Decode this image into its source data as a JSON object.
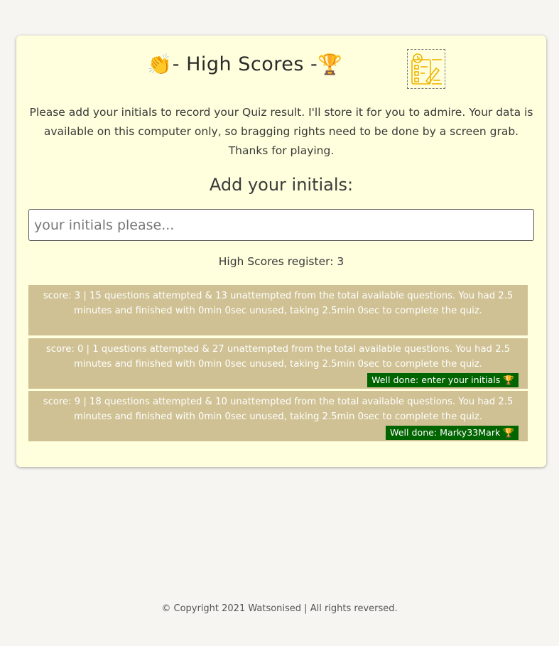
{
  "header": {
    "title_left_emoji": "👏",
    "title_text": "- High Scores -",
    "title_right_emoji": "🏆",
    "logo_icon": "quiz-clipboard-icon"
  },
  "intro": {
    "text": "Please add your initials to record your Quiz result. I'll store it for you to admire. Your data is available on this computer only, so bragging rights need to be done by a screen grab. Thanks for playing."
  },
  "form": {
    "heading": "Add your initials:",
    "placeholder": "your initials please..."
  },
  "register": {
    "label": "High Scores register: 3"
  },
  "scores": [
    {
      "text": "score: 3 | 15 questions attempted & 13 unattempted from the total available questions. You had 2.5 minutes and finished with 0min 0sec unused, taking 2.5min 0sec to complete the quiz.",
      "badge": ""
    },
    {
      "text": "score: 0 | 1 questions attempted & 27 unattempted from the total available questions. You had 2.5 minutes and finished with 0min 0sec unused, taking 2.5min 0sec to complete the quiz.",
      "badge": "Well done: enter your initials 🏆"
    },
    {
      "text": "score: 9 | 18 questions attempted & 10 unattempted from the total available questions. You had 2.5 minutes and finished with 0min 0sec unused, taking 2.5min 0sec to complete the quiz.",
      "badge": "Well done: Marky33Mark 🏆"
    }
  ],
  "footer": {
    "text": "© Copyright 2021 Watsonised | All rights reversed."
  },
  "colors": {
    "page_bg": "#f6f5f2",
    "card_bg": "#fffedd",
    "score_row_bg": "#cfc193",
    "badge_bg": "#006400",
    "logo_accent": "#f0b400"
  }
}
